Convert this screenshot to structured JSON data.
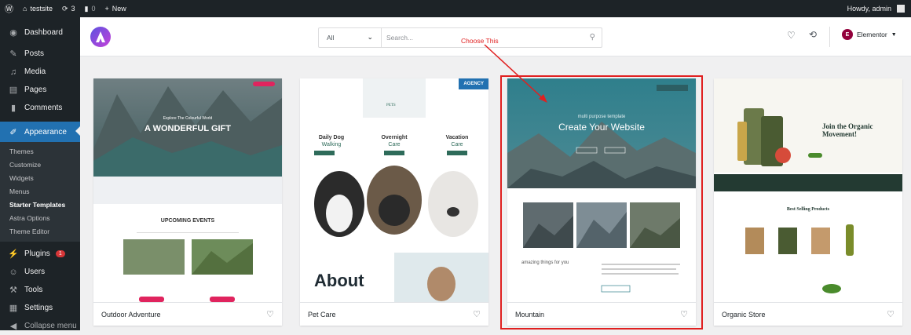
{
  "admin_bar": {
    "site_name": "testsite",
    "updates_count": "3",
    "comments_count": "0",
    "new_label": "New",
    "howdy": "Howdy, admin"
  },
  "sidebar": {
    "items": [
      {
        "label": "Dashboard",
        "icon": "dashboard-icon"
      },
      {
        "label": "Posts",
        "icon": "pin-icon"
      },
      {
        "label": "Media",
        "icon": "media-icon"
      },
      {
        "label": "Pages",
        "icon": "pages-icon"
      },
      {
        "label": "Comments",
        "icon": "comment-icon"
      },
      {
        "label": "Appearance",
        "icon": "brush-icon"
      }
    ],
    "submenu": [
      "Themes",
      "Customize",
      "Widgets",
      "Menus",
      "Starter Templates",
      "Astra Options",
      "Theme Editor"
    ],
    "items_after": [
      {
        "label": "Plugins",
        "icon": "plugin-icon",
        "badge": "1"
      },
      {
        "label": "Users",
        "icon": "users-icon"
      },
      {
        "label": "Tools",
        "icon": "wrench-icon"
      },
      {
        "label": "Settings",
        "icon": "settings-icon"
      },
      {
        "label": "Collapse menu",
        "icon": "collapse-icon"
      }
    ]
  },
  "toolbar": {
    "filter_value": "All",
    "search_placeholder": "Search...",
    "builder_label": "Elementor"
  },
  "annotation": {
    "text": "Choose This"
  },
  "cards": [
    {
      "name": "Outdoor Adventure",
      "hero_tagline": "Explore The Colourful World",
      "hero_title": "A WONDERFUL GIFT",
      "section_title": "UPCOMING EVENTS"
    },
    {
      "name": "Pet Care",
      "badge": "AGENCY",
      "logo_text": "PETS",
      "col1_top": "Daily Dog",
      "col1_bottom": "Walking",
      "col2_top": "Overnight",
      "col2_bottom": "Care",
      "col3_top": "Vacation",
      "col3_bottom": "Care",
      "about": "About"
    },
    {
      "name": "Mountain",
      "hero_tagline": "multi purpose template",
      "hero_title": "Create Your Website",
      "section_text": "amazing things for you"
    },
    {
      "name": "Organic Store",
      "hero_title": "Join the Organic Movement!",
      "section_title": "Best Selling Products"
    }
  ],
  "colors": {
    "admin_dark": "#1d2327",
    "accent_blue": "#2271b1",
    "highlight_red": "#e02020",
    "organic_green": "#4a8b2c"
  }
}
